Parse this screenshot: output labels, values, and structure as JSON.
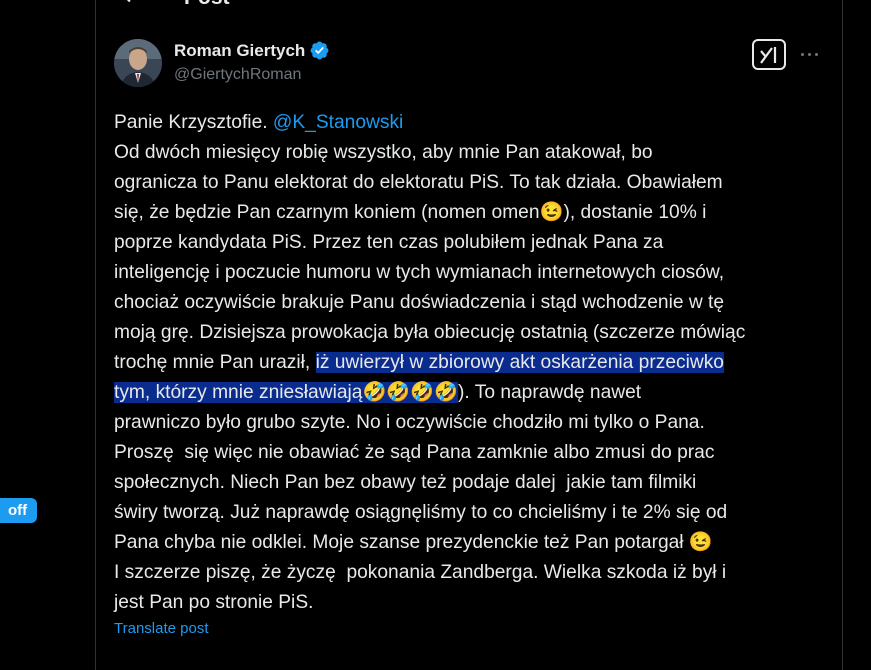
{
  "header": {
    "title": "Post"
  },
  "sidebar": {
    "badge_text": "off"
  },
  "author": {
    "name": "Roman Giertych",
    "handle": "@GiertychRoman"
  },
  "post": {
    "l1_prefix": "Panie Krzysztofie. ",
    "l1_mention": "@K_Stanowski",
    "l2": "Od dwóch miesięcy robię wszystko, aby mnie Pan atakował, bo",
    "l3": "ogranicza to Panu elektorat do elektoratu PiS. To tak działa. Obawiałem",
    "l4a": "się, że będzie Pan czarnym koniem (nomen omen",
    "l4_emoji": "😉",
    "l4b": "), dostanie 10% i",
    "l5": "poprze kandydata PiS. Przez ten czas polubiłem jednak Pana za",
    "l6": "inteligencję i poczucie humoru w tych wymianach internetowych ciosów,",
    "l7": "chociaż oczywiście brakuje Panu doświadczenia i stąd wchodzenie w tę",
    "l8": "moją grę. Dzisiejsza prowokacja była obiecucję ostatnią (szczerze mówiąc",
    "l9a": "trochę mnie Pan uraził, ",
    "l9_hl": "iż uwierzył w zbiorowy akt oskarżenia przeciwko",
    "l10_hl": "tym, którzy mnie zniesławiają🤣🤣🤣🤣",
    "l10b": "). To naprawdę nawet",
    "l11": "prawniczo było grubo szyte. No i oczywiście chodziło mi tylko o Pana.",
    "l12": "Proszę  się więc nie obawiać że sąd Pana zamknie albo zmusi do prac",
    "l13": "społecznych. Niech Pan bez obawy też podaje dalej  jakie tam filmiki",
    "l14": "świry tworzą. Już naprawdę osiągnęliśmy to co chcieliśmy i te 2% się od",
    "l15a": "Pana chyba nie odklei. Moje szanse prezydenckie też Pan potargał ",
    "l15_emoji": "😉",
    "l16": "I szczerze piszę, że życzę  pokonania Zandberga. Wielka szkoda iż był i",
    "l17": "jest Pan po stronie PiS."
  },
  "translate": {
    "label": "Translate post"
  },
  "colors": {
    "accent": "#1d9bf0",
    "highlight": "#0a2c8f",
    "background": "#000000",
    "text": "#e7e9ea",
    "muted": "#71767b"
  }
}
